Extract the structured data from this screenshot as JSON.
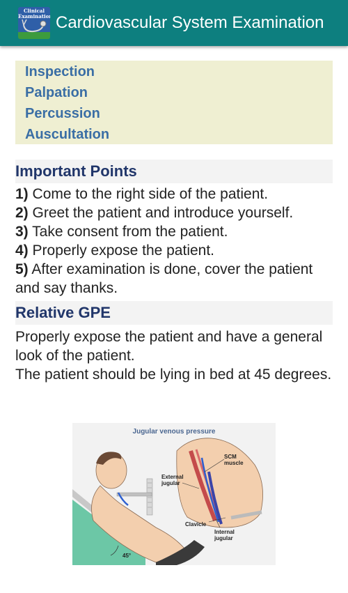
{
  "header": {
    "title": "Cardiovascular System Examination",
    "app_icon_text": "Clinical Examination",
    "color": "#0d7f7f"
  },
  "toc": {
    "items": [
      {
        "label": "Inspection"
      },
      {
        "label": "Palpation"
      },
      {
        "label": "Percussion"
      },
      {
        "label": "Auscultation"
      }
    ]
  },
  "important_points": {
    "heading": "Important Points",
    "items": [
      {
        "num": "1)",
        "text": " Come to the right side of the patient."
      },
      {
        "num": "2)",
        "text": " Greet the patient and introduce yourself."
      },
      {
        "num": "3)",
        "text": " Take consent from the patient."
      },
      {
        "num": "4)",
        "text": " Properly expose the patient."
      },
      {
        "num": "5)",
        "text": " After examination is done, cover the patient and say thanks."
      }
    ]
  },
  "relative_gpe": {
    "heading": "Relative GPE",
    "text1": "Properly expose the patient and have a general look of the patient.",
    "text2": "The patient should be lying in bed at 45 degrees."
  },
  "figure": {
    "title": "Jugular venous pressure",
    "labels": {
      "scm": "SCM muscle",
      "external_jugular": "External jugular",
      "clavicle": "Clavicle",
      "internal_jugular": "Internal jugular",
      "angle": "45°"
    }
  }
}
